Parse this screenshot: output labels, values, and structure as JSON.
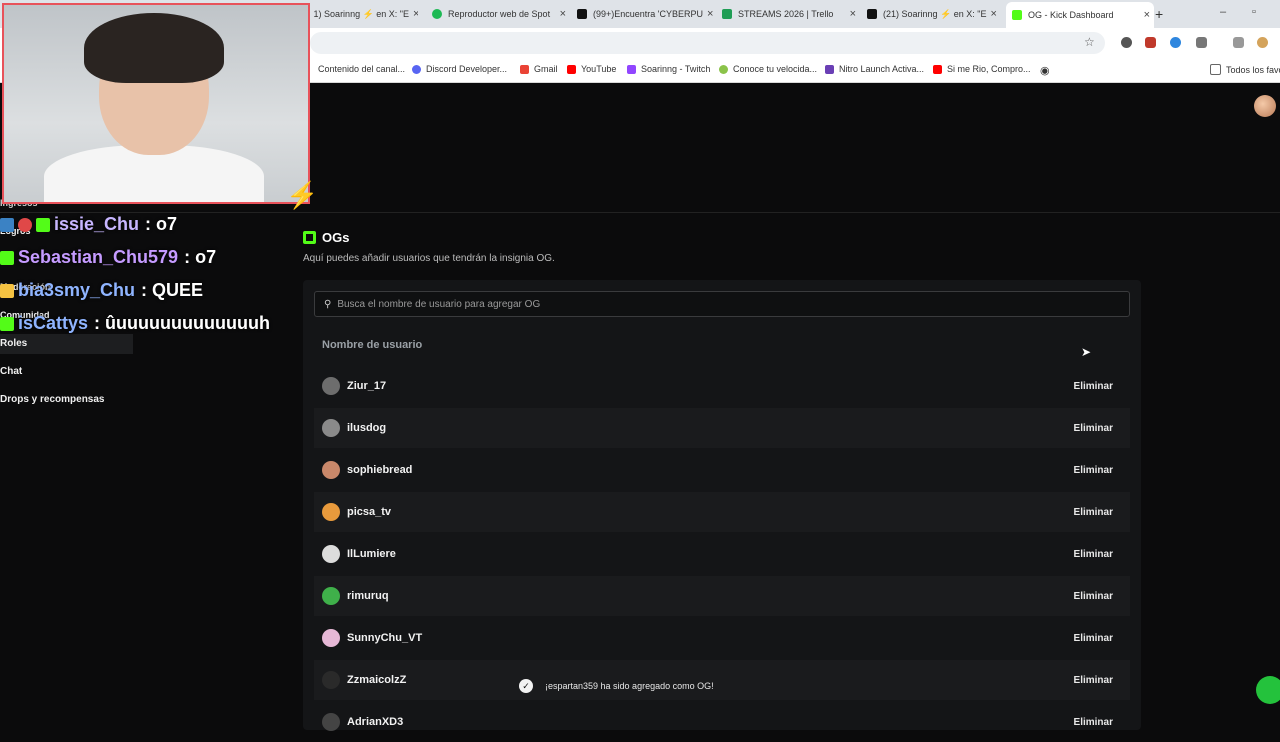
{
  "browser": {
    "tabs": [
      {
        "title": "1) Soarinng ⚡ en X: \"E",
        "favicon": "x-icon"
      },
      {
        "title": "Reproductor web de Spot",
        "favicon": "spotify-icon"
      },
      {
        "title": "(99+)Encuentra 'CYBERPU",
        "favicon": "tiktok-icon"
      },
      {
        "title": "STREAMS 2026 | Trello",
        "favicon": "trello-icon"
      },
      {
        "title": "(21) Soarinng ⚡ en X: \"E",
        "favicon": "x-icon"
      },
      {
        "title": "OG - Kick Dashboard",
        "favicon": "kick-icon",
        "active": true
      }
    ],
    "new_tab": "+",
    "bookmarks": [
      {
        "label": "Contenido del canal...",
        "icon": "youtube-studio-icon"
      },
      {
        "label": "Discord Developer...",
        "icon": "discord-icon"
      },
      {
        "label": "Gmail",
        "icon": "gmail-icon"
      },
      {
        "label": "YouTube",
        "icon": "youtube-icon"
      },
      {
        "label": "Soarinng - Twitch",
        "icon": "twitch-icon"
      },
      {
        "label": "Conoce tu velocida...",
        "icon": "speedtest-icon"
      },
      {
        "label": "Nitro Launch Activa...",
        "icon": "nitro-icon"
      },
      {
        "label": "Si me Rio, Compro...",
        "icon": "youtube-icon"
      },
      {
        "label": "Todos los favoritos",
        "icon": "folder-icon"
      }
    ]
  },
  "sidebar": {
    "items": [
      "Ingresos",
      "Logros",
      "Moderación",
      "Comunidad",
      "Roles",
      "Chat",
      "Drops y recompensas"
    ]
  },
  "overlay": {
    "chat": [
      {
        "user": "issie_Chu",
        "message": ": o7",
        "color": "#c7b6ff"
      },
      {
        "user": "Sebastian_Chu579",
        "message": ": o7",
        "color": "#c59bff"
      },
      {
        "user": "bia3smy_Chu",
        "message": ": QUEE",
        "color": "#8fb4ff"
      },
      {
        "user": "isCattys",
        "message": ": ûuuuuuuuuuuuuuh",
        "color": "#8fb4ff"
      }
    ]
  },
  "main": {
    "title": "OGs",
    "subtitle": "Aquí puedes añadir usuarios que tendrán la insignia OG.",
    "search_placeholder": "Busca el nombre de usuario para agregar OG",
    "column_header": "Nombre de usuario",
    "remove_label": "Eliminar",
    "users": [
      {
        "name": "Ziur_17",
        "avatar_color": "#6d6d6d"
      },
      {
        "name": "ilusdog",
        "avatar_color": "#8a8a8a"
      },
      {
        "name": "sophiebread",
        "avatar_color": "#c9886a"
      },
      {
        "name": "picsa_tv",
        "avatar_color": "#e89a3c"
      },
      {
        "name": "IlLumiere",
        "avatar_color": "#dcdcdc"
      },
      {
        "name": "rimuruq",
        "avatar_color": "#3fb04a"
      },
      {
        "name": "SunnyChu_VT",
        "avatar_color": "#e6b8d6"
      },
      {
        "name": "ZzmaicolzZ",
        "avatar_color": "#2a2a2a"
      },
      {
        "name": "AdrianXD3",
        "avatar_color": "#444444"
      }
    ],
    "toast": "¡espartan359 ha sido agregado como OG!"
  },
  "colors": {
    "accent": "#53fc18",
    "background": "#0b0b0c",
    "card": "#141517"
  }
}
